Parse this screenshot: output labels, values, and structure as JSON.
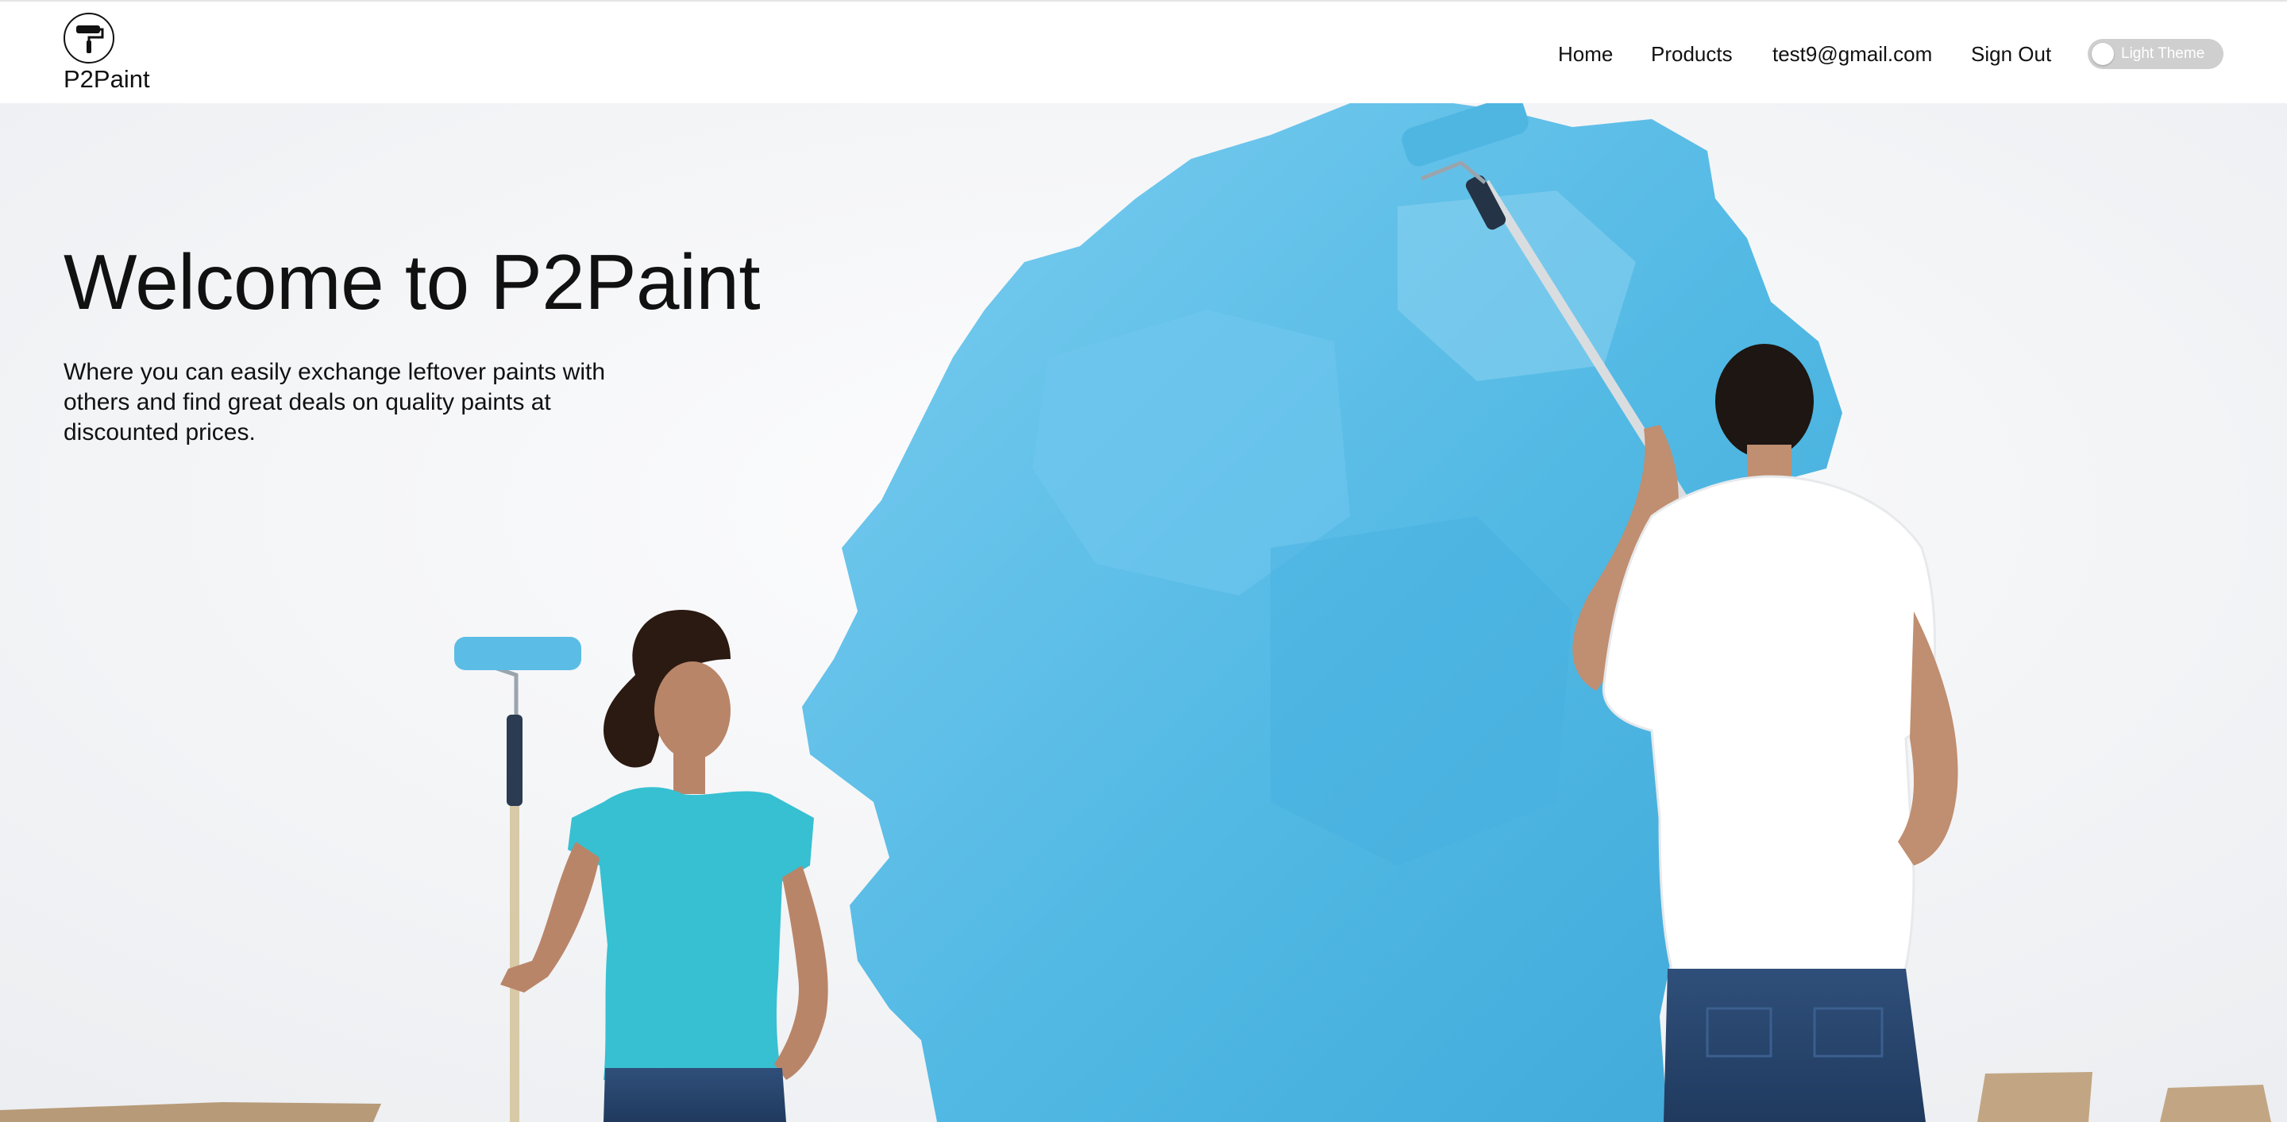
{
  "brand": {
    "name": "P2Paint",
    "logo_icon": "paint-roller-icon"
  },
  "nav": {
    "home": "Home",
    "products": "Products",
    "user_email": "test9@gmail.com",
    "sign_out": "Sign Out",
    "theme_toggle_label": "Light Theme"
  },
  "hero": {
    "title": "Welcome to P2Paint",
    "subtitle": "Where you can easily exchange leftover paints with others and find great deals on quality paints at discounted prices.",
    "image": "photo of a woman holding a paint roller and a man painting a white wall light blue"
  },
  "colors": {
    "paint_blue": "#5bbde6",
    "toggle_bg": "#cfcfcf",
    "text": "#111111"
  }
}
